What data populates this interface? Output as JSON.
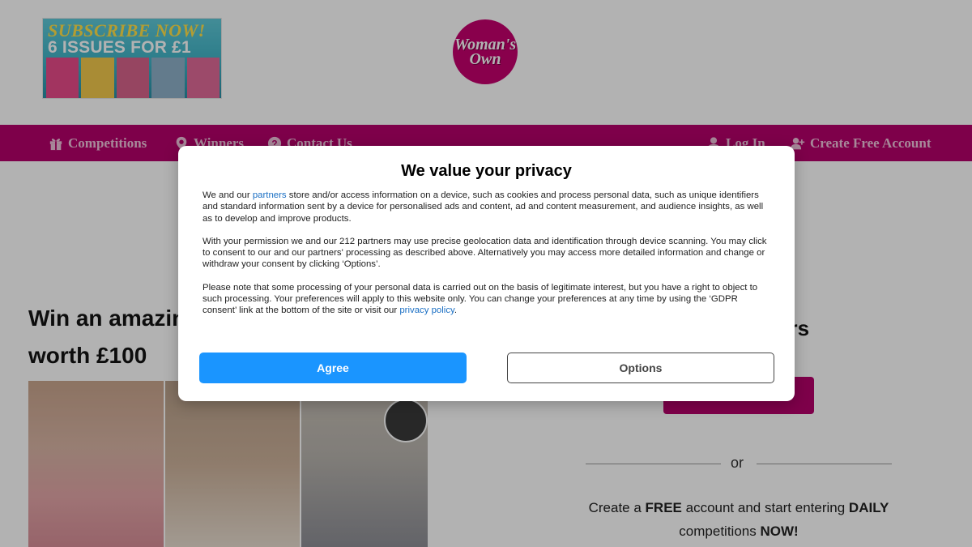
{
  "header": {
    "promo": {
      "line1": "SUBSCRIBE NOW!",
      "line2": "6 ISSUES FOR £1"
    },
    "logo": {
      "line1": "Woman's",
      "line2": "Own"
    }
  },
  "nav": {
    "competitions": "Competitions",
    "winners": "Winners",
    "contact": "Contact Us",
    "login": "Log In",
    "create_account": "Create Free Account"
  },
  "main": {
    "headline_line1": "Win an amazin",
    "headline_line2": "worth £100",
    "partial_heading": "ers",
    "divider_or": "or",
    "promo_line1_a": "Create a ",
    "promo_line1_b": "FREE",
    "promo_line1_c": " account and start entering ",
    "promo_line1_d": "DAILY",
    "promo_line2_a": "competitions ",
    "promo_line2_b": "NOW!"
  },
  "consent": {
    "title": "We value your privacy",
    "p1_before_link": "We and our ",
    "p1_link": "partners",
    "p1_after_link": " store and/or access information on a device, such as cookies and process personal data, such as unique identifiers and standard information sent by a device for personalised ads and content, ad and content measurement, and audience insights, as well as to develop and improve products.",
    "p2": "With your permission we and our 212 partners may use precise geolocation data and identification through device scanning. You may click to consent to our and our partners' processing as described above. Alternatively you may access more detailed information and change or withdraw your consent by clicking ‘Options’.",
    "p3_before_link": "Please note that some processing of your personal data is carried out on the basis of legitimate interest, but you have a right to object to such processing. Your preferences will apply to this website only. You can change your preferences at any time by using the ‘GDPR consent’ link at the bottom of the site or visit our ",
    "p3_link": "privacy policy",
    "p3_after_link": ".",
    "agree_label": "Agree",
    "options_label": "Options"
  },
  "colors": {
    "brand": "#b5006a",
    "agree": "#1a95ff",
    "link": "#1a6fc4"
  },
  "icons": {
    "competitions": "gift-icon",
    "winners": "map-pin-icon",
    "contact": "question-circle-icon",
    "login": "user-icon",
    "create_account": "user-plus-icon"
  }
}
